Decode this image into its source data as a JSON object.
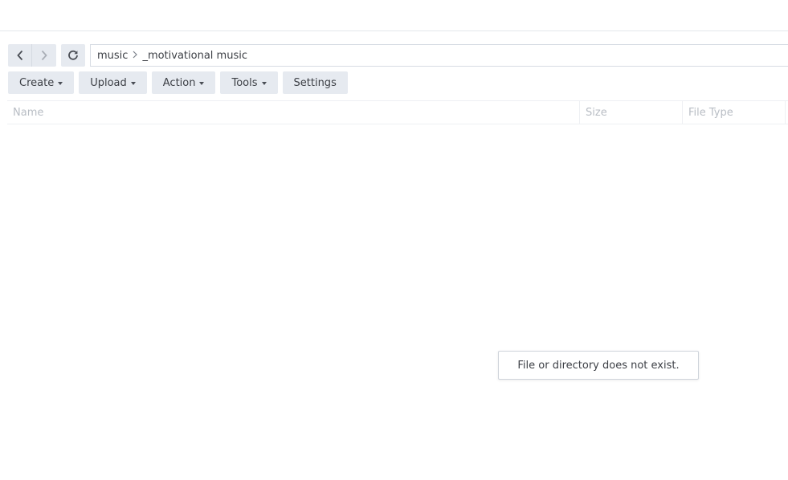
{
  "nav": {
    "back_icon": "chevron-left-icon",
    "forward_icon": "chevron-right-icon",
    "refresh_icon": "refresh-icon",
    "path": [
      "music",
      "_motivational music"
    ],
    "path_separator_icon": "chevron-right-icon"
  },
  "toolbar": {
    "create_label": "Create",
    "upload_label": "Upload",
    "action_label": "Action",
    "tools_label": "Tools",
    "settings_label": "Settings"
  },
  "columns": {
    "name": "Name",
    "size": "Size",
    "file_type": "File Type"
  },
  "toast": {
    "message": "File or directory does not exist."
  },
  "colors": {
    "button_bg": "#e6eaf0",
    "header_text": "#b8bdc4",
    "border": "#d7dce3"
  }
}
